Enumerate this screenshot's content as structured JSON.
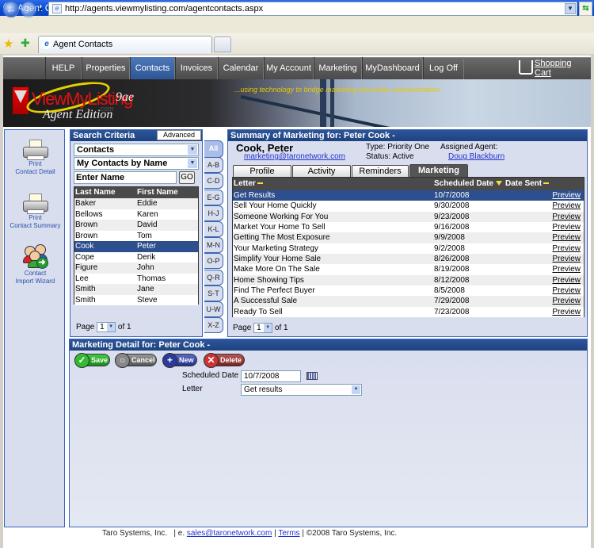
{
  "browser": {
    "title": "Agent Contacts - Windows Internet Explorer",
    "url": "http://agents.viewmylisting.com/agentcontacts.aspx",
    "tab_label": "Agent Contacts"
  },
  "menu": {
    "items": [
      "HELP",
      "Properties",
      "Contacts",
      "Invoices",
      "Calendar",
      "My Account",
      "Marketing",
      "MyDashboard",
      "Log Off"
    ],
    "active": "Contacts",
    "cart_label": "Shopping Cart"
  },
  "banner": {
    "logo": "ViewMyListing",
    "logo_domain": ".com",
    "version": "9ae",
    "edition": "Agent Edition",
    "tagline": "...using technology to bridge marketing and seller communication"
  },
  "tools": [
    {
      "label1": "Print",
      "label2": "Contact Detail",
      "icon": "printer-icon"
    },
    {
      "label1": "Print",
      "label2": "Contact Summary",
      "icon": "printer-icon"
    },
    {
      "label1": "Contact",
      "label2": "Import Wizard",
      "icon": "contacts-import-icon"
    }
  ],
  "search": {
    "title": "Search Criteria",
    "advanced_label": "Advanced",
    "type_select": "Contacts",
    "view_select": "My Contacts by Name",
    "name_placeholder": "Enter Name",
    "go_label": "GO",
    "columns": [
      "Last Name",
      "First Name"
    ],
    "rows": [
      [
        "Baker",
        "Eddie"
      ],
      [
        "Bellows",
        "Karen"
      ],
      [
        "Brown",
        "David"
      ],
      [
        "Brown",
        "Tom"
      ],
      [
        "Cook",
        "Peter"
      ],
      [
        "Cope",
        "Derik"
      ],
      [
        "Figure",
        "John"
      ],
      [
        "Lee",
        "Thomas"
      ],
      [
        "Smith",
        "Jane"
      ],
      [
        "Smith",
        "Steve"
      ]
    ],
    "selected_index": 4,
    "page_label": "Page",
    "page": "1",
    "of_label": "of 1"
  },
  "alpha_tabs": [
    "All",
    "A-B",
    "C-D",
    "E-G",
    "H-J",
    "K-L",
    "M-N",
    "O-P",
    "Q-R",
    "S-T",
    "U-W",
    "X-Z"
  ],
  "summary": {
    "title": "Summary of Marketing for: Peter Cook -",
    "name": "Cook, Peter",
    "email": "marketing@taronetwork.com",
    "type": "Type: Priority One",
    "status": "Status: Active",
    "agent_label": "Assigned Agent:",
    "agent": "Doug Blackburn",
    "tabs": [
      "Profile",
      "Activity",
      "Reminders",
      "Marketing"
    ],
    "active_tab": "Marketing",
    "columns": [
      "Letter",
      "Scheduled Date",
      "Date Sent"
    ],
    "rows": [
      {
        "letter": "Get Results",
        "date": "10/7/2008",
        "action": "Preview"
      },
      {
        "letter": "Sell Your Home Quickly",
        "date": "9/30/2008",
        "action": "Preview"
      },
      {
        "letter": "Someone Working For You",
        "date": "9/23/2008",
        "action": "Preview"
      },
      {
        "letter": "Market Your Home To Sell",
        "date": "9/16/2008",
        "action": "Preview"
      },
      {
        "letter": "Getting The Most Exposure",
        "date": "9/9/2008",
        "action": "Preview"
      },
      {
        "letter": "Your Marketing Strategy",
        "date": "9/2/2008",
        "action": "Preview"
      },
      {
        "letter": "Simplify Your Home Sale",
        "date": "8/26/2008",
        "action": "Preview"
      },
      {
        "letter": "Make More On The Sale",
        "date": "8/19/2008",
        "action": "Preview"
      },
      {
        "letter": "Home Showing Tips",
        "date": "8/12/2008",
        "action": "Preview"
      },
      {
        "letter": "Find The Perfect Buyer",
        "date": "8/5/2008",
        "action": "Preview"
      },
      {
        "letter": "A Successful Sale",
        "date": "7/29/2008",
        "action": "Preview"
      },
      {
        "letter": "Ready To Sell",
        "date": "7/23/2008",
        "action": "Preview"
      }
    ],
    "selected_index": 0,
    "page_label": "Page",
    "page": "1",
    "of_label": "of 1"
  },
  "detail": {
    "title": "Marketing Detail for: Peter Cook -",
    "buttons": {
      "save": "Save",
      "cancel": "Cancel",
      "new": "New",
      "delete": "Delete"
    },
    "scheduled_label": "Scheduled Date",
    "scheduled_value": "10/7/2008",
    "letter_label": "Letter",
    "letter_value": "Get results"
  },
  "footer": {
    "company": "Taro Systems, Inc.",
    "email_prefix": "| e.",
    "email": "sales@taronetwork.com",
    "sep": "|",
    "terms": "Terms",
    "copyright": "| ©2008  Taro Systems, Inc."
  },
  "colors": {
    "header_blue": "#2e559c",
    "panel_bg": "#d9deef",
    "selected_row": "#2e4f8e",
    "menu_active": "#3a66a8",
    "link": "#2233cc"
  }
}
